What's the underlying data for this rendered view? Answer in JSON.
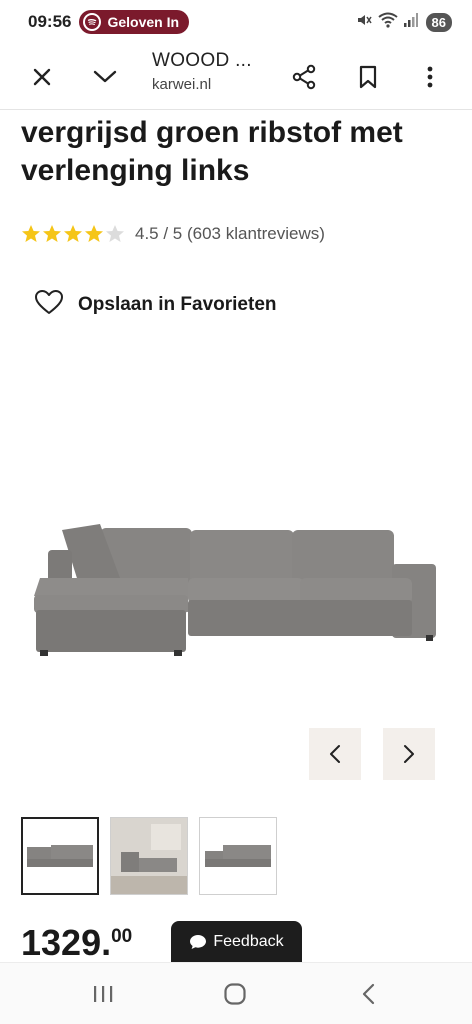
{
  "status_bar": {
    "time": "09:56",
    "media_label": "Geloven In",
    "battery": "86"
  },
  "browser": {
    "page_title": "WOOOD ...",
    "url": "karwei.nl"
  },
  "product": {
    "title": "vergrijsd groen ribstof met verlenging links",
    "rating_value": 4.5,
    "rating_text": "4.5 / 5 (603 klantreviews)",
    "favorite_label": "Opslaan in Favorieten",
    "price_main": "1329.",
    "price_cents": "00"
  },
  "feedback": {
    "label": "Feedback"
  },
  "colors": {
    "star": "#f5c518",
    "spotify_pill": "#7b1a2c",
    "arrow_bg": "#f3efeb"
  }
}
